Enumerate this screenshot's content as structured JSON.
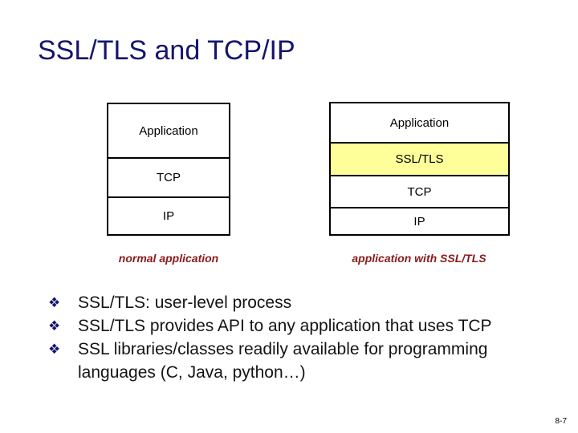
{
  "slide": {
    "title": "SSL/TLS and TCP/IP",
    "page_number": "8-7",
    "title_color": "#15156e",
    "highlight_color": "#ffff99",
    "caption_color": "#8b1a1a",
    "border_color": "#000000"
  },
  "diagram": {
    "left_stack": {
      "caption": "normal application",
      "layers": [
        {
          "label": "Application",
          "highlight": false
        },
        {
          "label": "TCP",
          "highlight": false
        },
        {
          "label": "IP",
          "highlight": false
        }
      ]
    },
    "right_stack": {
      "caption": "application  with SSL/TLS",
      "layers": [
        {
          "label": "Application",
          "highlight": false
        },
        {
          "label": "SSL/TLS",
          "highlight": true
        },
        {
          "label": "TCP",
          "highlight": false
        },
        {
          "label": "IP",
          "highlight": false
        }
      ]
    }
  },
  "bullets": {
    "marker": "❖",
    "items": [
      "SSL/TLS: user-level process",
      "SSL/TLS provides API to any application that uses TCP",
      "SSL libraries/classes readily available for programming languages (C, Java, python…)"
    ]
  }
}
